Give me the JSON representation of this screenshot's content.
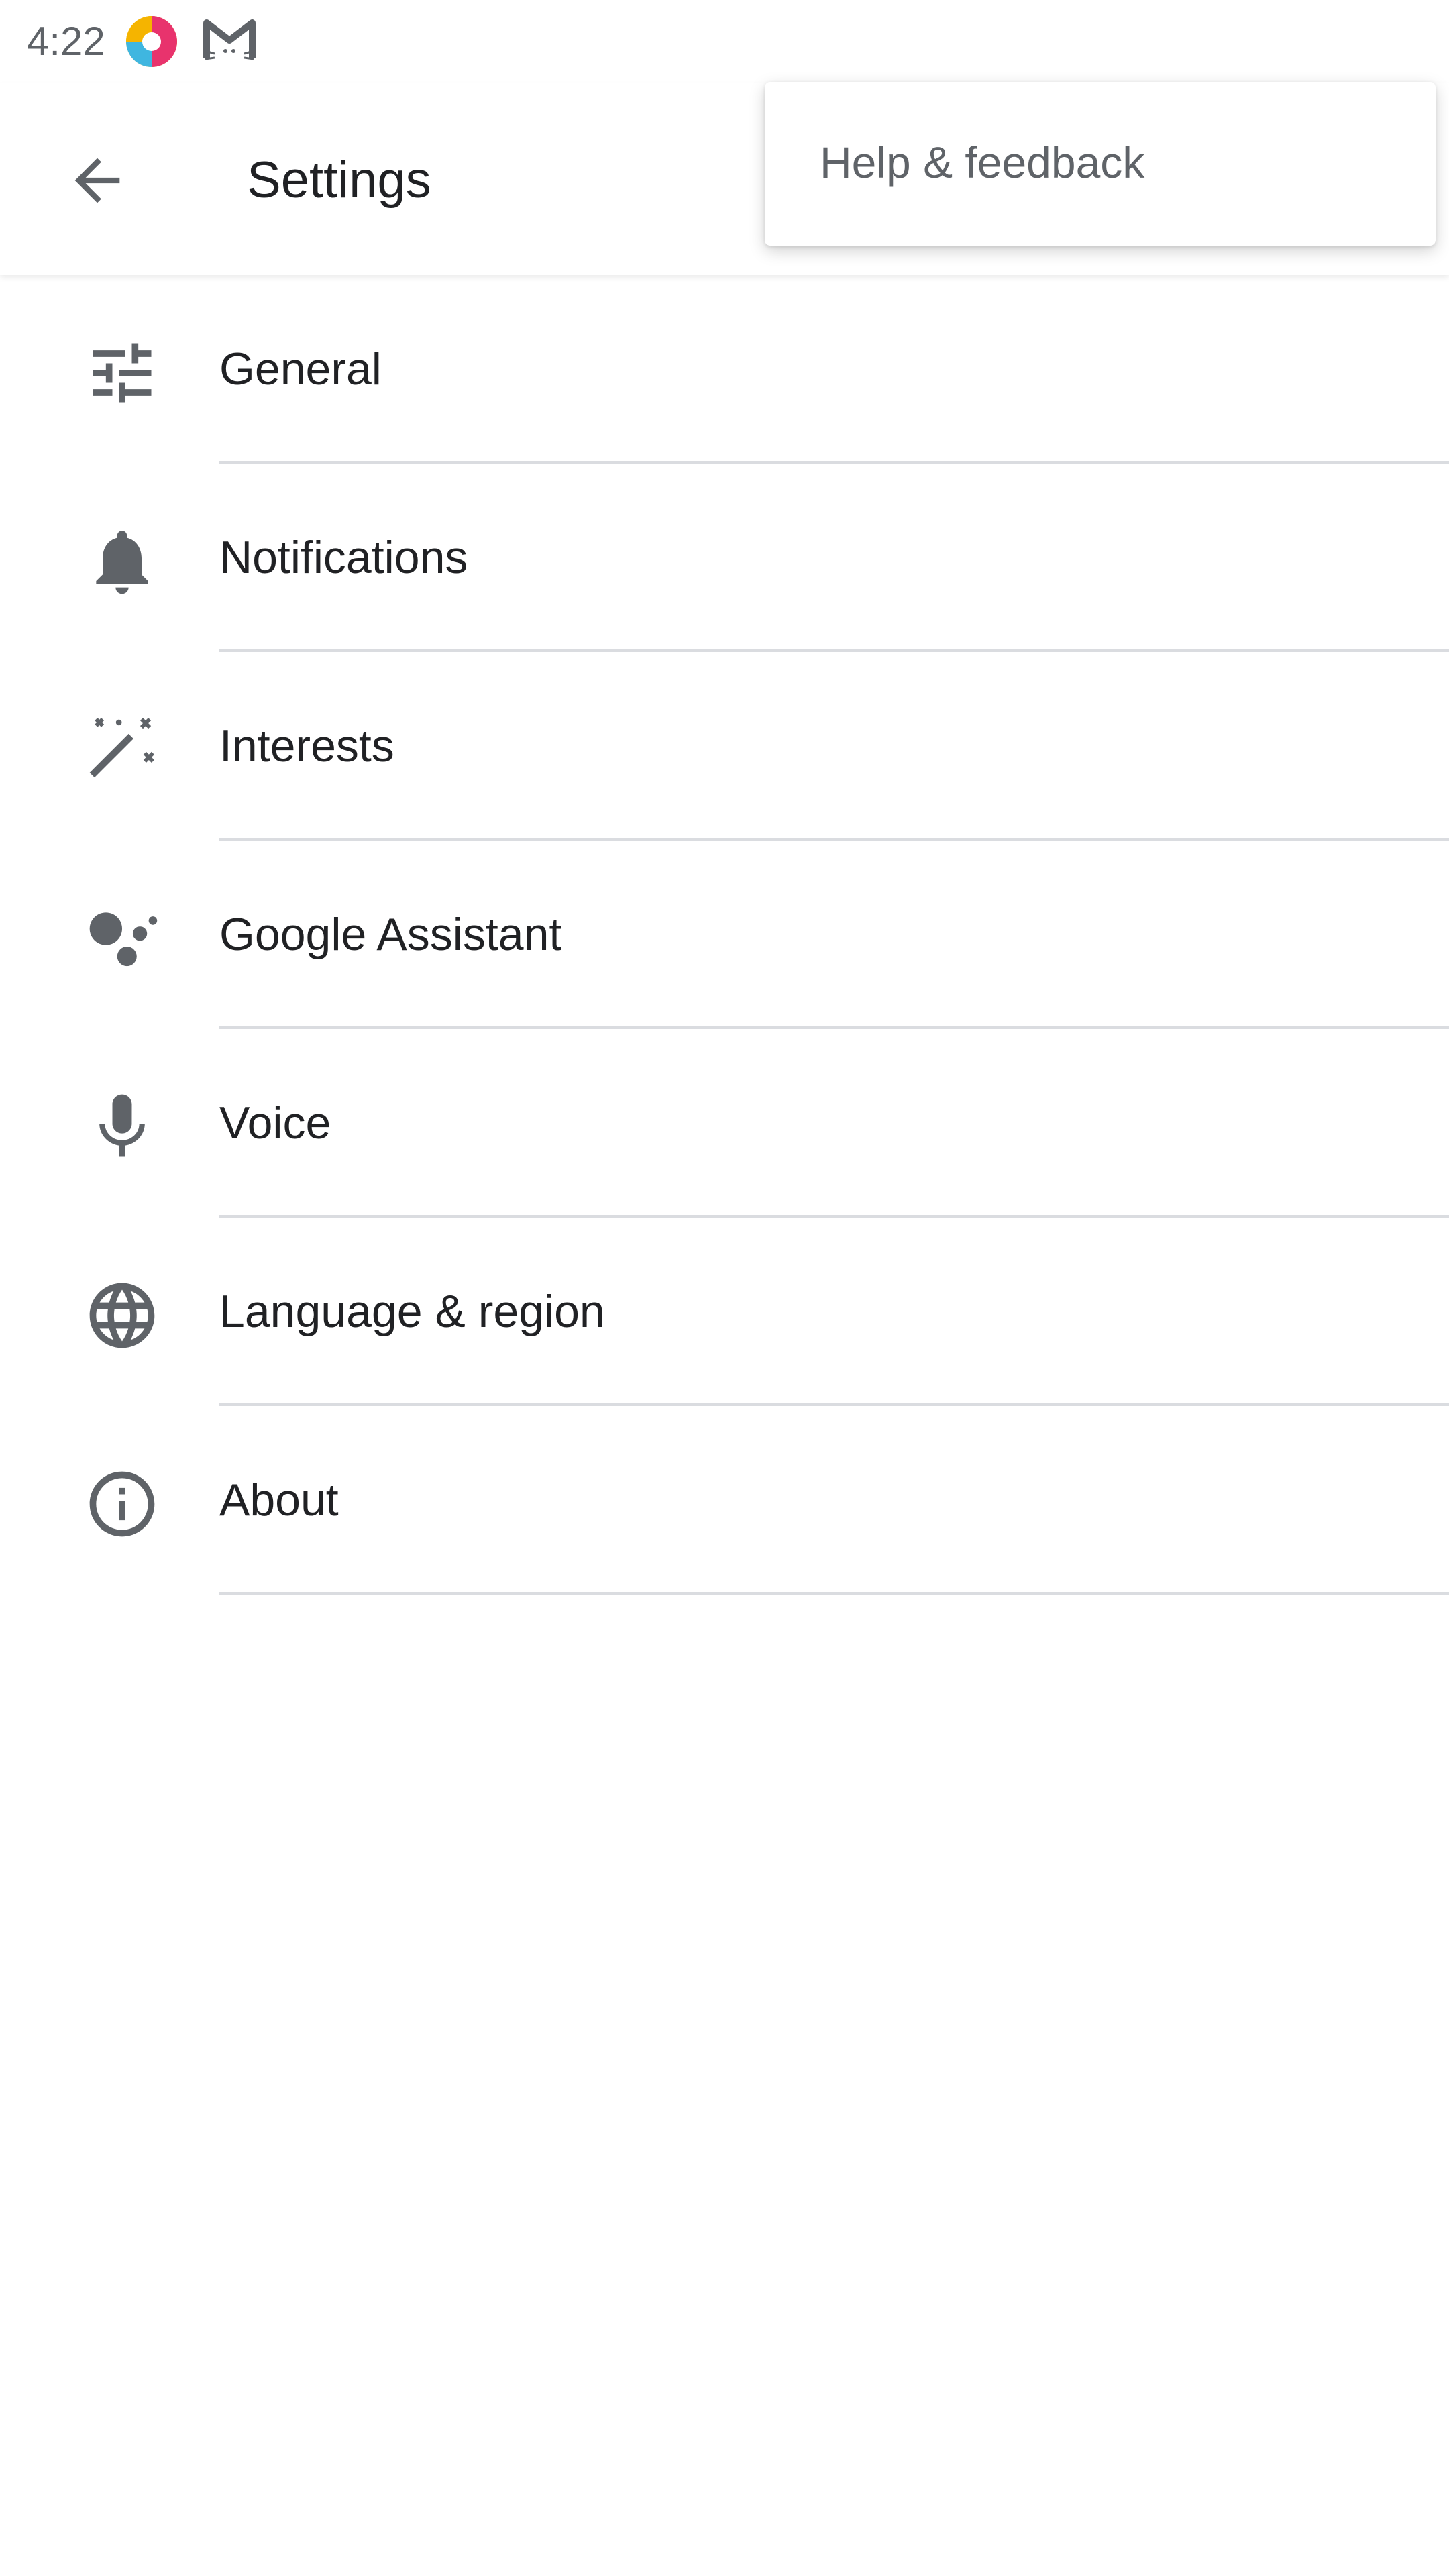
{
  "status_bar": {
    "time": "4:22",
    "icons": [
      "app-logo-icon",
      "gmail-cat-icon"
    ]
  },
  "app_bar": {
    "back_icon": "arrow-back-icon",
    "title": "Settings"
  },
  "overflow_menu": {
    "items": [
      {
        "label": "Help & feedback"
      }
    ]
  },
  "settings": {
    "items": [
      {
        "label": "General",
        "icon": "tune-icon"
      },
      {
        "label": "Notifications",
        "icon": "bell-icon"
      },
      {
        "label": "Interests",
        "icon": "magic-wand-icon"
      },
      {
        "label": "Google Assistant",
        "icon": "assistant-dots-icon"
      },
      {
        "label": "Voice",
        "icon": "microphone-icon"
      },
      {
        "label": "Language & region",
        "icon": "globe-icon"
      },
      {
        "label": "About",
        "icon": "info-icon"
      }
    ]
  },
  "colors": {
    "icon": "#5f6368",
    "text": "#202124",
    "divider": "#dadce0",
    "menu_text": "#5f6368"
  }
}
